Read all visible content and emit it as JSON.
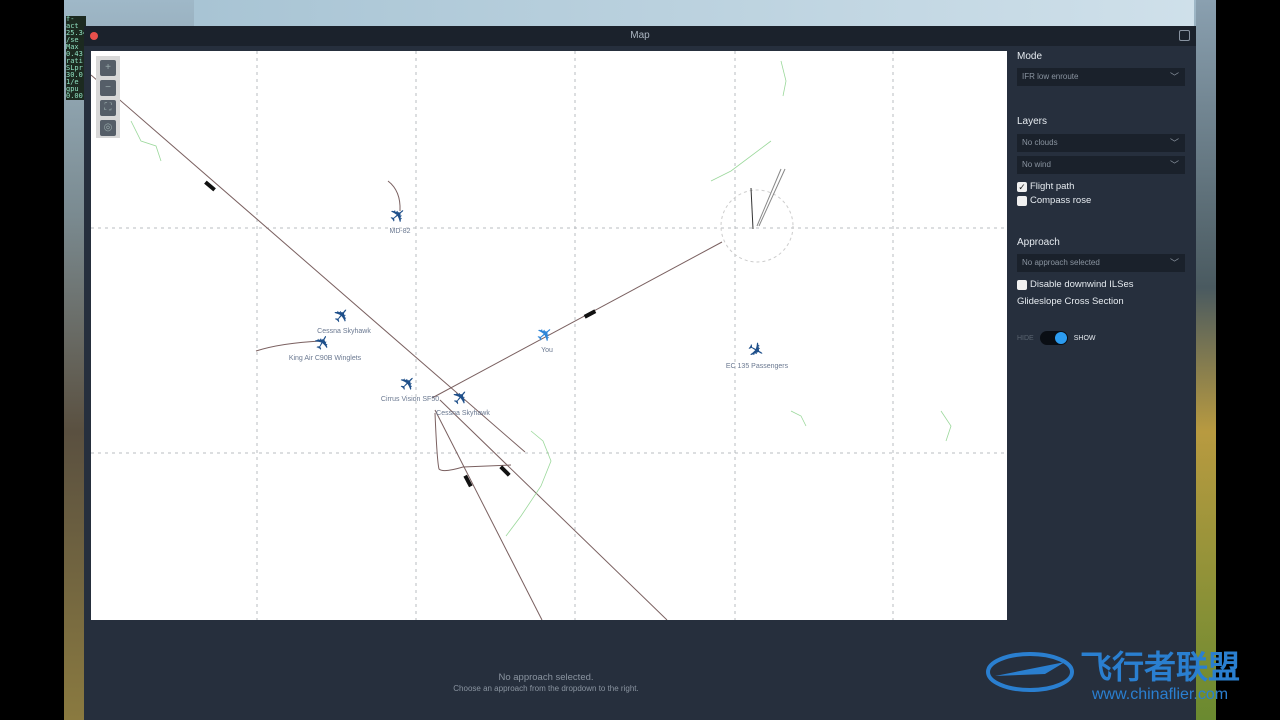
{
  "window": {
    "title": "Map"
  },
  "hud": {
    "lines": [
      "f-act",
      "25.34",
      "/se",
      "Max",
      "0.43",
      "rati",
      "SLpr",
      "30.0",
      "1/e",
      "gpu",
      "0.00"
    ]
  },
  "zoom_controls": [
    "+",
    "−",
    "⛶",
    "◎"
  ],
  "map": {
    "aircraft": [
      {
        "label": "MD-82",
        "rot": -40
      },
      {
        "label": "Cessna Skyhawk",
        "rot": -50
      },
      {
        "label": "King Air C90B Winglets",
        "rot": -60
      },
      {
        "label": "Cirrus Vision SF50",
        "rot": -45
      },
      {
        "label": "Cessna Skyhawk",
        "rot": -50
      },
      {
        "label": "You",
        "rot": -40,
        "you": true
      },
      {
        "label": "EC 135 Passengers",
        "rot": 30
      }
    ]
  },
  "sidebar": {
    "mode_heading": "Mode",
    "mode_value": "IFR low enroute",
    "layers_heading": "Layers",
    "clouds_value": "No clouds",
    "wind_value": "No wind",
    "flight_path": {
      "label": "Flight path",
      "checked": true
    },
    "compass_rose": {
      "label": "Compass rose",
      "checked": false
    },
    "approach_heading": "Approach",
    "approach_value": "No approach selected",
    "disable_ils": {
      "label": "Disable downwind ILSes",
      "checked": false
    },
    "glideslope_label": "Glideslope Cross Section",
    "toggle_off": "HIDE",
    "toggle_on": "SHOW",
    "toggle_state": "SHOW"
  },
  "bottom": {
    "title": "No approach selected.",
    "subtitle": "Choose an approach from the dropdown to the right."
  },
  "watermark": {
    "text": "飞行者联盟",
    "url": "www.chinaflier.com"
  },
  "colors": {
    "accent": "#2c9cf0",
    "aircraft": "#1e4f8a",
    "close": "#e8504c"
  }
}
